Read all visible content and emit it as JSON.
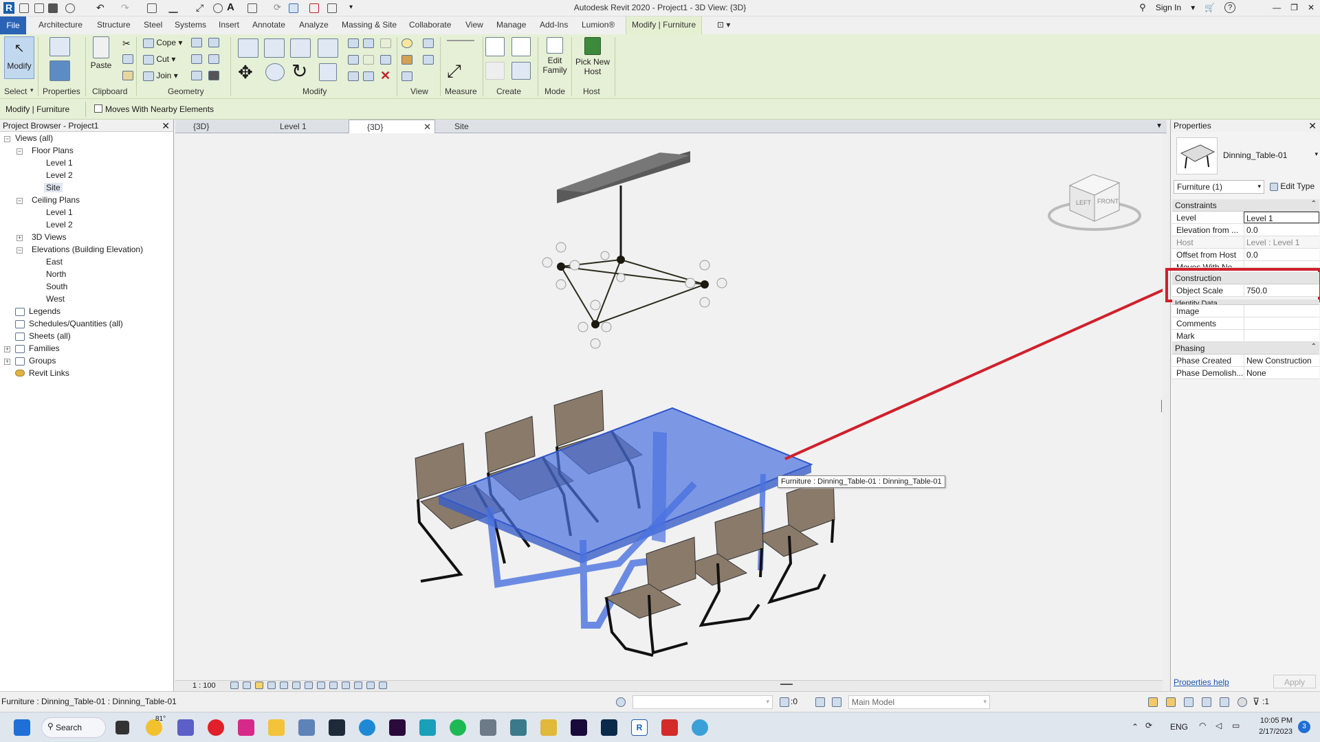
{
  "app": {
    "title": "Autodesk Revit 2020 - Project1 - 3D View: {3D}",
    "sign_in": "Sign In"
  },
  "tabs": [
    "File",
    "Architecture",
    "Structure",
    "Steel",
    "Systems",
    "Insert",
    "Annotate",
    "Analyze",
    "Massing & Site",
    "Collaborate",
    "View",
    "Manage",
    "Add-Ins",
    "Lumion®",
    "Modify | Furniture"
  ],
  "ribbon": {
    "tools": {
      "modify": "Modify",
      "properties": "Properties",
      "paste": "Paste",
      "cope": "Cope",
      "cut": "Cut",
      "join": "Join",
      "view": "View",
      "measure": "Measure",
      "create": "Create",
      "edit_family": "Edit Family",
      "pick_new_host": "Pick New Host"
    },
    "panels": {
      "select": "Select",
      "properties": "Properties",
      "clipboard": "Clipboard",
      "geometry": "Geometry",
      "modify": "Modify",
      "view": "View",
      "measure": "Measure",
      "create": "Create",
      "mode": "Mode",
      "host": "Host"
    }
  },
  "options_bar": {
    "context": "Modify | Furniture",
    "moves_with": "Moves With Nearby Elements"
  },
  "project_browser": {
    "title": "Project Browser - Project1",
    "items": [
      "Views (all)",
      "Floor Plans",
      "Level 1",
      "Level 2",
      "Site",
      "Ceiling Plans",
      "Level 1",
      "Level 2",
      "3D Views",
      "Elevations (Building Elevation)",
      "East",
      "North",
      "South",
      "West",
      "Legends",
      "Schedules/Quantities (all)",
      "Sheets (all)",
      "Families",
      "Groups",
      "Revit Links"
    ]
  },
  "view_tabs": [
    "{3D}",
    "Level 1",
    "{3D}",
    "Site"
  ],
  "view_cube": {
    "left": "LEFT",
    "front": "FRONT"
  },
  "tooltip": "Furniture : Dinning_Table-01 : Dinning_Table-01",
  "view_control": {
    "scale": "1 : 100"
  },
  "properties": {
    "title": "Properties",
    "type_name": "Dinning_Table-01",
    "selector": "Furniture (1)",
    "edit_type": "Edit Type",
    "groups": {
      "constraints": "Constraints",
      "construction": "Construction",
      "identity": "Identity Data",
      "phasing": "Phasing"
    },
    "rows": [
      {
        "k": "Level",
        "v": "Level 1"
      },
      {
        "k": "Elevation from ...",
        "v": "0.0"
      },
      {
        "k": "Host",
        "v": "Level : Level 1"
      },
      {
        "k": "Offset from Host",
        "v": "0.0"
      },
      {
        "k": "Moves With Ne...",
        "v": ""
      },
      {
        "k": "Object Scale",
        "v": "750.0"
      },
      {
        "k": "Image",
        "v": ""
      },
      {
        "k": "Comments",
        "v": ""
      },
      {
        "k": "Mark",
        "v": ""
      },
      {
        "k": "Phase Created",
        "v": "New Construction"
      },
      {
        "k": "Phase Demolish...",
        "v": "None"
      }
    ],
    "help": "Properties help",
    "apply": "Apply"
  },
  "status": {
    "left": "Furniture : Dinning_Table-01 : Dinning_Table-01",
    "coord": ":0",
    "model": "Main Model",
    "filter": ":1"
  },
  "taskbar": {
    "search": "Search",
    "temp": "81°",
    "lang": "ENG",
    "time": "10:05 PM",
    "date": "2/17/2023",
    "badge": "3"
  },
  "colors": {
    "selection": "#4a72e0",
    "highlight": "#d0202b",
    "ribbon": "#e6f0d6",
    "file_tab": "#2a63b5"
  }
}
